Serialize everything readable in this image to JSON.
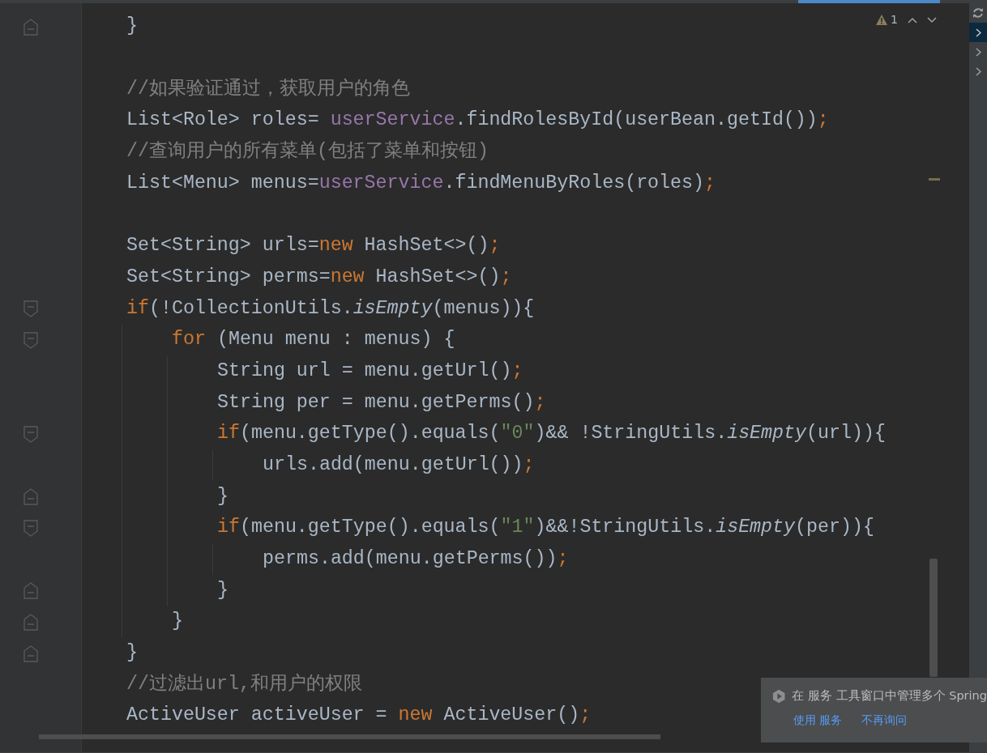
{
  "editor": {
    "lines": [
      {
        "kind": "close",
        "tokens": [
          {
            "kind": "plain",
            "text": "}"
          }
        ]
      },
      {
        "kind": "blank"
      },
      {
        "kind": "code",
        "tokens": [
          {
            "kind": "comment",
            "text": "//如果验证通过，获取用户的角色"
          }
        ]
      },
      {
        "kind": "code",
        "tokens": [
          {
            "kind": "plain",
            "text": "List<Role> roles= "
          },
          {
            "kind": "field",
            "text": "userService"
          },
          {
            "kind": "plain",
            "text": ".findRolesById(userBean.getId())"
          },
          {
            "kind": "keyword",
            "text": ";"
          }
        ]
      },
      {
        "kind": "code",
        "tokens": [
          {
            "kind": "comment",
            "text": "//查询用户的所有菜单(包括了菜单和按钮)"
          }
        ]
      },
      {
        "kind": "code",
        "tokens": [
          {
            "kind": "plain",
            "text": "List<Menu> menus="
          },
          {
            "kind": "field",
            "text": "userService"
          },
          {
            "kind": "plain",
            "text": ".findMenuByRoles(roles)"
          },
          {
            "kind": "keyword",
            "text": ";"
          }
        ]
      },
      {
        "kind": "blank"
      },
      {
        "kind": "code",
        "tokens": [
          {
            "kind": "plain",
            "text": "Set<String> urls="
          },
          {
            "kind": "keyword",
            "text": "new"
          },
          {
            "kind": "plain",
            "text": " HashSet<>()"
          },
          {
            "kind": "keyword",
            "text": ";"
          }
        ]
      },
      {
        "kind": "code",
        "tokens": [
          {
            "kind": "plain",
            "text": "Set<String> perms="
          },
          {
            "kind": "keyword",
            "text": "new"
          },
          {
            "kind": "plain",
            "text": " HashSet<>()"
          },
          {
            "kind": "keyword",
            "text": ";"
          }
        ]
      },
      {
        "kind": "code",
        "tokens": [
          {
            "kind": "keyword",
            "text": "if"
          },
          {
            "kind": "plain",
            "text": "(!CollectionUtils."
          },
          {
            "kind": "static",
            "text": "isEmpty"
          },
          {
            "kind": "plain",
            "text": "(menus)){"
          }
        ],
        "children": [
          {
            "kind": "code",
            "tokens": [
              {
                "kind": "keyword",
                "text": "for"
              },
              {
                "kind": "plain",
                "text": " (Menu menu : menus) {"
              }
            ],
            "children": [
              {
                "kind": "code",
                "tokens": [
                  {
                    "kind": "plain",
                    "text": "String url = menu.getUrl()"
                  },
                  {
                    "kind": "keyword",
                    "text": ";"
                  }
                ]
              },
              {
                "kind": "code",
                "tokens": [
                  {
                    "kind": "plain",
                    "text": "String per = menu.getPerms()"
                  },
                  {
                    "kind": "keyword",
                    "text": ";"
                  }
                ]
              },
              {
                "kind": "code",
                "tokens": [
                  {
                    "kind": "keyword",
                    "text": "if"
                  },
                  {
                    "kind": "plain",
                    "text": "(menu.getType().equals("
                  },
                  {
                    "kind": "string",
                    "text": "\"0\""
                  },
                  {
                    "kind": "plain",
                    "text": ")&& !StringUtils."
                  },
                  {
                    "kind": "static",
                    "text": "isEmpty"
                  },
                  {
                    "kind": "plain",
                    "text": "(url)){"
                  }
                ],
                "children": [
                  {
                    "kind": "code",
                    "tokens": [
                      {
                        "kind": "plain",
                        "text": "urls.add(menu.getUrl())"
                      },
                      {
                        "kind": "keyword",
                        "text": ";"
                      }
                    ]
                  }
                ]
              },
              {
                "kind": "close",
                "tokens": [
                  {
                    "kind": "plain",
                    "text": "}"
                  }
                ]
              },
              {
                "kind": "code",
                "tokens": [
                  {
                    "kind": "keyword",
                    "text": "if"
                  },
                  {
                    "kind": "plain",
                    "text": "(menu.getType().equals("
                  },
                  {
                    "kind": "string",
                    "text": "\"1\""
                  },
                  {
                    "kind": "plain",
                    "text": ")&&!StringUtils."
                  },
                  {
                    "kind": "static",
                    "text": "isEmpty"
                  },
                  {
                    "kind": "plain",
                    "text": "(per)){"
                  }
                ],
                "children": [
                  {
                    "kind": "code",
                    "tokens": [
                      {
                        "kind": "plain",
                        "text": "perms.add(menu.getPerms())"
                      },
                      {
                        "kind": "keyword",
                        "text": ";"
                      }
                    ]
                  }
                ]
              },
              {
                "kind": "close",
                "tokens": [
                  {
                    "kind": "plain",
                    "text": "}"
                  }
                ]
              }
            ]
          },
          {
            "kind": "close",
            "tokens": [
              {
                "kind": "plain",
                "text": "}"
              }
            ]
          }
        ]
      },
      {
        "kind": "close",
        "tokens": [
          {
            "kind": "plain",
            "text": "}"
          }
        ]
      },
      {
        "kind": "code",
        "tokens": [
          {
            "kind": "comment",
            "text": "//过滤出url,和用户的权限"
          }
        ]
      },
      {
        "kind": "code",
        "tokens": [
          {
            "kind": "plain",
            "text": "ActiveUser activeUser = "
          },
          {
            "kind": "keyword",
            "text": "new"
          },
          {
            "kind": "plain",
            "text": " ActiveUser()"
          },
          {
            "kind": "keyword",
            "text": ";"
          }
        ]
      }
    ]
  },
  "inspection": {
    "warnings": "1"
  },
  "tool_strip": {
    "items": [
      {
        "selected": true
      },
      {
        "selected": false
      },
      {
        "selected": false
      }
    ]
  },
  "notification": {
    "message": "在 服务 工具窗口中管理多个 Spring",
    "actions": [
      "使用 服务",
      "不再询问"
    ]
  }
}
